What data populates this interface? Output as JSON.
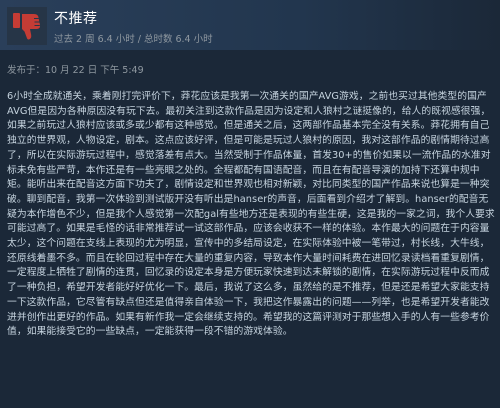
{
  "review": {
    "verdict": "不推荐",
    "hours_line": "过去 2 周 6.4 小时 / 总时数 6.4 小时",
    "posted": "发布于：10 月 22 日 下午 5:49",
    "body": "6小时全成就通关，乘着刚打完评价下，莽花应该是我第一次通关的国产AVG游戏，之前也买过其他类型的国产AVG但是因为各种原因没有玩下去。最初关注到这款作品是因为设定和人狼村之谜挺像的，给人的既视感很强，如果之前玩过人狼村应该或多或少都有这种感觉。但是通关之后，这两部作品基本完全没有关系。莽花拥有自己独立的世界观，人物设定，剧本。这点应该好评，但是可能是玩过人狼村的原因，我对这部作品的剧情期待过高了，所以在实际游玩过程中，感觉落差有点大。当然受制于作品体量，首发30+的售价如果以一流作品的水准对标未免有些严苛，本作还是有一些亮眼之处的。全程都配有国语配音，而且在有配音导演的加持下还算中规中矩。能听出来在配音这方面下功夫了，剧情设定和世界观也相对新颖，对比同类型的国产作品来说也算是一种突破。聊到配音，我第一次体验到测试版开没有听出是hanser的声音，后面看到介绍才了解到。hanser的配音无疑为本作增色不少，但是我个人感觉第一次配gal有些地方还是表现的有些生硬，这是我的一家之词，我个人要求可能过高了。如果是毛怪的话非常推荐试一试这部作品，应该会收获不一样的体验。本作最大的问题在于内容量太少，这个问题在支线上表现的尤为明显，宣传中的多结局设定，在实际体验中被一笔带过，村长线，大牛线，还原线着墨不多。而且在轮回过程中存在大量的重复内容，导致本作大量时间耗费在进回忆录读档看重复剧情，一定程度上牺牲了剧情的连贯，回忆录的设定本身是方便玩家快速到达未解锁的剧情，在实际游玩过程中反而成了一种负担，希望开发者能好好优化一下。最后，我说了这么多，虽然给的是不推荐，但是还是希望大家能支持一下这款作品，它尽管有缺点但还是值得亲自体验一下，我把这作暴露出的问题——列举，也是希望开发者能改进并创作出更好的作品。如果有新作我一定会继续支持的。希望我的这篇评测对于那些想入手的人有一些参考价值，如果能接受它的一些缺点，一定能获得一段不错的游戏体验。"
  },
  "icons": {
    "thumb": "thumbs-down-icon"
  },
  "colors": {
    "background": "#1b2838",
    "header": "#2a3f5a",
    "thumb": "#c53c35",
    "text": "#c6d4df",
    "muted": "#8f98a0"
  }
}
